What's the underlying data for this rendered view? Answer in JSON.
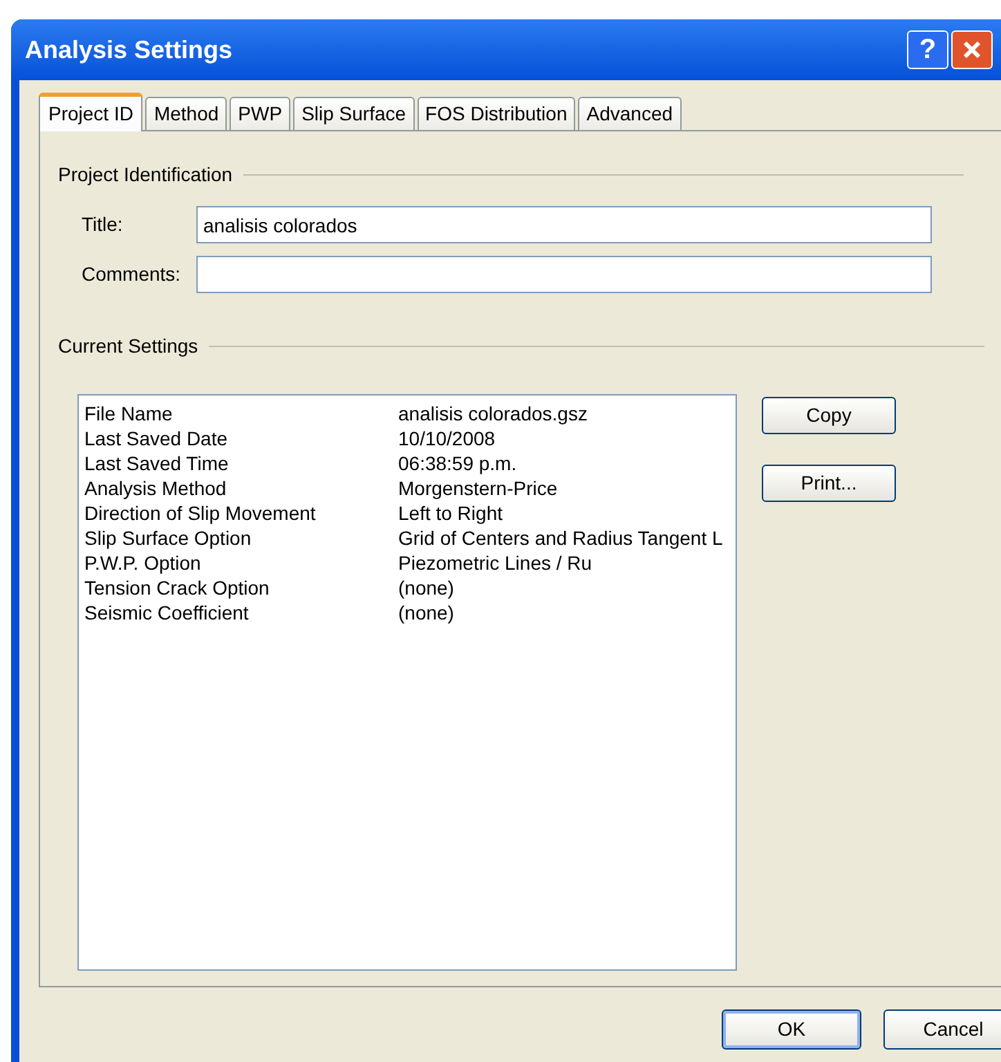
{
  "window": {
    "title": "Analysis Settings",
    "help_glyph": "?"
  },
  "tabs": [
    {
      "label": "Project ID",
      "selected": true
    },
    {
      "label": "Method",
      "selected": false
    },
    {
      "label": "PWP",
      "selected": false
    },
    {
      "label": "Slip Surface",
      "selected": false
    },
    {
      "label": "FOS Distribution",
      "selected": false
    },
    {
      "label": "Advanced",
      "selected": false
    }
  ],
  "project_identification": {
    "heading": "Project Identification",
    "fields": [
      {
        "label": "Title:",
        "value": "analisis colorados"
      },
      {
        "label": "Comments:"
      }
    ]
  },
  "current_settings": {
    "heading": "Current Settings",
    "rows": [
      {
        "name": "File Name",
        "value": "analisis colorados.gsz"
      },
      {
        "name": "Last Saved Date",
        "value": "10/10/2008"
      },
      {
        "name": "Last Saved Time",
        "value": "06:38:59 p.m."
      },
      {
        "name": "Analysis Method",
        "value": "Morgenstern-Price"
      },
      {
        "name": "Direction of Slip Movement",
        "value": "Left to Right"
      },
      {
        "name": "Slip Surface Option",
        "value": "Grid of Centers and Radius Tangent L"
      },
      {
        "name": "P.W.P. Option",
        "value": "Piezometric Lines / Ru"
      },
      {
        "name": "Tension Crack Option",
        "value": "(none)"
      },
      {
        "name": "Seismic Coefficient",
        "value": "(none)"
      }
    ],
    "buttons": [
      "Copy",
      "Print..."
    ]
  },
  "buttons": [
    {
      "label": "OK",
      "default": true
    },
    {
      "label": "Cancel",
      "default": false
    }
  ]
}
